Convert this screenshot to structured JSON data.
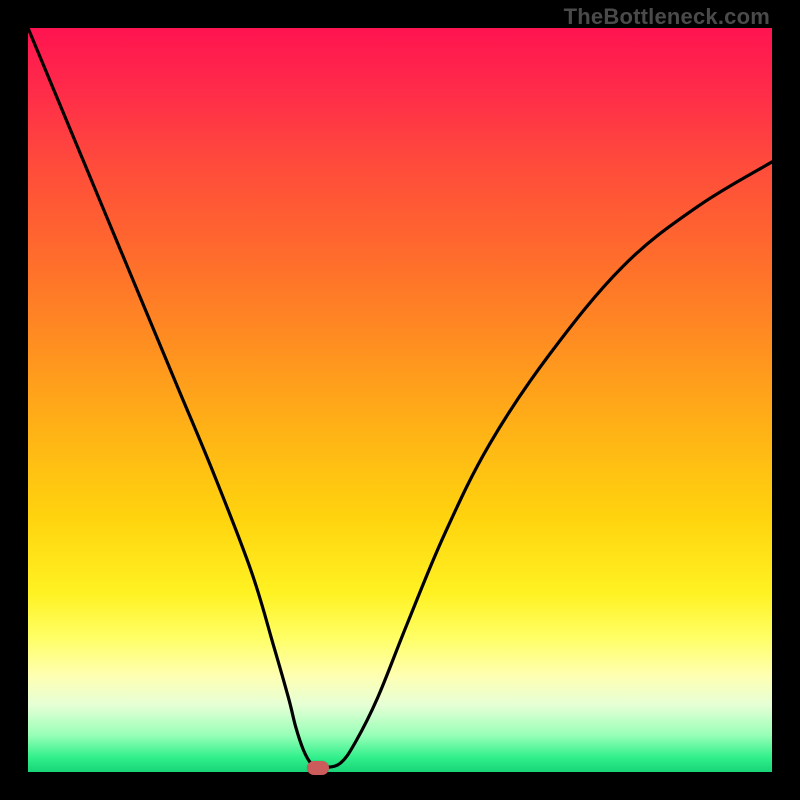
{
  "watermark": "TheBottleneck.com",
  "chart_data": {
    "type": "line",
    "title": "",
    "xlabel": "",
    "ylabel": "",
    "xlim": [
      0,
      100
    ],
    "ylim": [
      0,
      100
    ],
    "grid": false,
    "series": [
      {
        "name": "curve",
        "x": [
          0,
          5,
          10,
          15,
          20,
          25,
          30,
          33,
          35,
          36,
          37,
          38,
          39,
          40,
          42,
          44,
          47,
          51,
          56,
          62,
          70,
          80,
          90,
          100
        ],
        "values": [
          100,
          88,
          76,
          64,
          52,
          40,
          27,
          17,
          10,
          6,
          3,
          1.2,
          0.6,
          0.6,
          1.2,
          4,
          10,
          20,
          32,
          44,
          56,
          68,
          76,
          82
        ]
      }
    ],
    "flat_floor": {
      "x_start": 37.5,
      "x_end": 41,
      "y": 0.6
    },
    "marker": {
      "x": 39,
      "y": 0.6,
      "color": "#cc5c5c"
    },
    "colors": {
      "curve": "#000000",
      "marker": "#cc5c5c",
      "gradient_top": "#ff1450",
      "gradient_bottom": "#17d477",
      "frame": "#000000"
    }
  }
}
